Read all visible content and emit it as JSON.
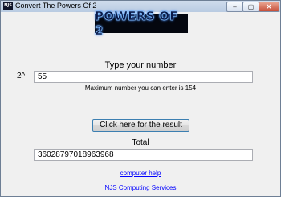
{
  "window": {
    "title": "Convert The Powers Of 2",
    "icon": "app-icon",
    "icon_text": "NJS",
    "controls": {
      "minimize": "–",
      "maximize": "▢",
      "close": "✕"
    }
  },
  "banner": {
    "text": "POWERS OF 2"
  },
  "input_section": {
    "label": "Type your number",
    "prefix": "2^",
    "value": "55",
    "max_note": "Maximum number you can enter is 154"
  },
  "result_button": {
    "label": "Click here for the result"
  },
  "total_section": {
    "label": "Total",
    "value": "36028797018963968"
  },
  "links": {
    "help": "computer help",
    "company": "NJS Computing Services"
  },
  "colors": {
    "link": "#0000ff",
    "banner_bg": "#04070f",
    "banner_glow": "#6fb3ff"
  }
}
